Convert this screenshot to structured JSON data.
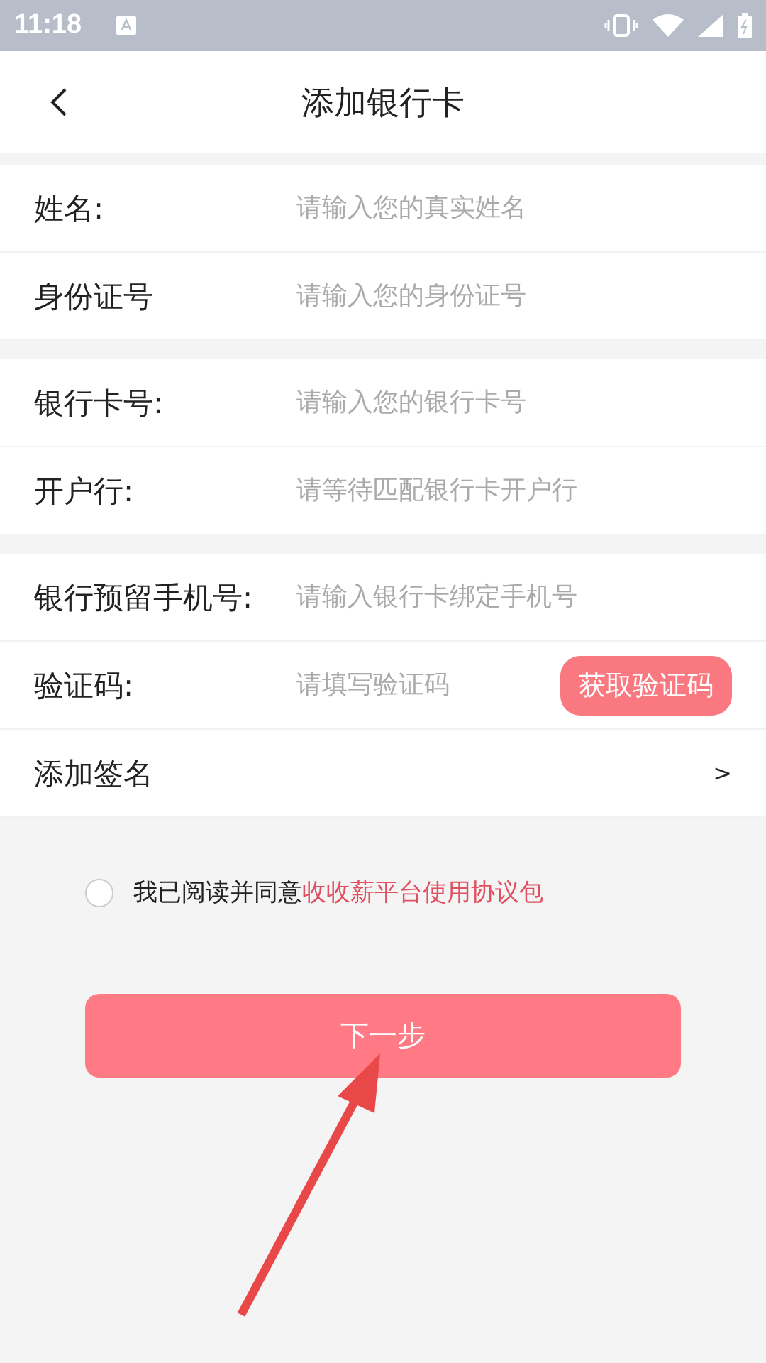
{
  "status_bar": {
    "time": "11:18"
  },
  "header": {
    "title": "添加银行卡"
  },
  "groups": [
    [
      {
        "kind": "input",
        "label": "姓名:",
        "placeholder": "请输入您的真实姓名"
      },
      {
        "kind": "input",
        "label": "身份证号",
        "placeholder": "请输入您的身份证号"
      }
    ],
    [
      {
        "kind": "input",
        "label": "银行卡号:",
        "placeholder": "请输入您的银行卡号"
      },
      {
        "kind": "input",
        "label": "开户行:",
        "placeholder": "请等待匹配银行卡开户行"
      }
    ],
    [
      {
        "kind": "input",
        "label": "银行预留手机号:",
        "placeholder": "请输入银行卡绑定手机号"
      },
      {
        "kind": "code",
        "label": "验证码:",
        "placeholder": "请填写验证码",
        "button": "获取验证码"
      },
      {
        "kind": "link",
        "label": "添加签名",
        "chevron": ">"
      }
    ]
  ],
  "agreement": {
    "checked": false,
    "text": "我已阅读并同意",
    "link": "收收薪平台使用协议包"
  },
  "next_button": "下一步"
}
